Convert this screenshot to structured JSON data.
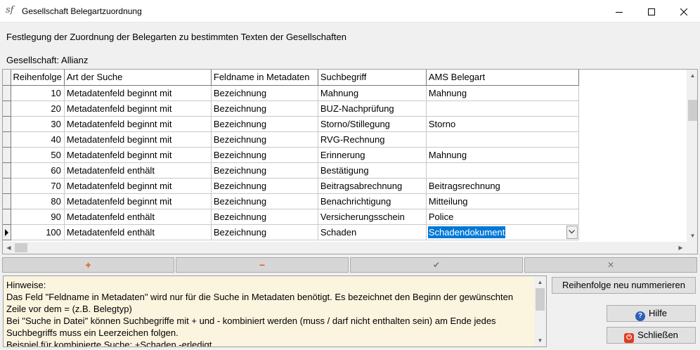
{
  "window": {
    "title": "Gesellschaft Belegartzuordnung",
    "app_icon_text": "sf"
  },
  "description": "Festlegung der Zuordnung der Belegarten zu bestimmten Texten der Gesellschaften",
  "company": "Gesellschaft: Allianz",
  "grid": {
    "columns": [
      "Reihenfolge",
      "Art der Suche",
      "Feldname in Metadaten",
      "Suchbegriff",
      "AMS Belegart"
    ],
    "rows": [
      [
        "10",
        "Metadatenfeld beginnt mit",
        "Bezeichnung",
        "Mahnung",
        "Mahnung"
      ],
      [
        "20",
        "Metadatenfeld beginnt mit",
        "Bezeichnung",
        "BUZ-Nachprüfung",
        ""
      ],
      [
        "30",
        "Metadatenfeld beginnt mit",
        "Bezeichnung",
        "Storno/Stillegung",
        "Storno"
      ],
      [
        "40",
        "Metadatenfeld beginnt mit",
        "Bezeichnung",
        "RVG-Rechnung",
        ""
      ],
      [
        "50",
        "Metadatenfeld beginnt mit",
        "Bezeichnung",
        "Erinnerung",
        "Mahnung"
      ],
      [
        "60",
        "Metadatenfeld enthält",
        "Bezeichnung",
        "Bestätigung",
        ""
      ],
      [
        "70",
        "Metadatenfeld beginnt mit",
        "Bezeichnung",
        "Beitragsabrechnung",
        "Beitragsrechnung"
      ],
      [
        "80",
        "Metadatenfeld beginnt mit",
        "Bezeichnung",
        "Benachrichtigung",
        "Mitteilung"
      ],
      [
        "90",
        "Metadatenfeld enthält",
        "Bezeichnung",
        "Versicherungsschein",
        "Police"
      ],
      [
        "100",
        "Metadatenfeld enthält",
        "Bezeichnung",
        "Schaden",
        "Schadendokument"
      ]
    ],
    "selected_row": 9
  },
  "navigator": {
    "add": "+",
    "delete": "−",
    "post": "✔",
    "cancel": "✕"
  },
  "notes": {
    "lines": [
      "Hinweise:",
      "Das Feld \"Feldname in Metadaten\" wird nur für die Suche in Metadaten benötigt. Es bezeichnet den Beginn der gewünschten",
      "Zeile vor dem = (z.B. Belegtyp)",
      "Bei \"Suche in Datei\" können Suchbegriffe mit + und - kombiniert werden (muss / darf nicht enthalten sein) am Ende jedes",
      "Suchbegriffs muss ein Leerzeichen folgen.",
      "Beispiel für kombinierte Suche: +Schaden -erledigt"
    ]
  },
  "buttons": {
    "renumber": "Reihenfolge neu nummerieren",
    "help": "Hilfe",
    "close": "Schließen"
  },
  "colors": {
    "selection": "#0078d7",
    "notes_background": "#fbf4df",
    "nav_icon_active": "#e8571b"
  }
}
